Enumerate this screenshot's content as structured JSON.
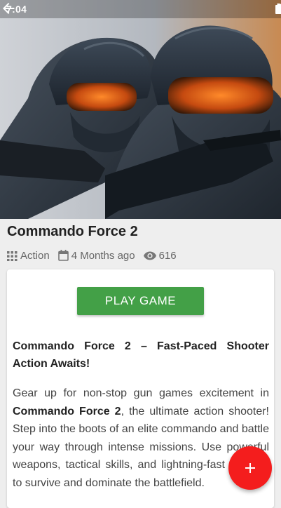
{
  "status_bar": {
    "time": "7:04",
    "icons": [
      "wifi-icon",
      "cell-signal-icon",
      "battery-icon"
    ]
  },
  "hero": {
    "image_subject": "two armed commandos in tactical helmets and goggles"
  },
  "toolbar": {
    "back_icon": "back-arrow-icon"
  },
  "game": {
    "title": "Commando Force 2",
    "category": "Action",
    "category_icon": "grid-icon",
    "date": "4 Months ago",
    "date_icon": "calendar-icon",
    "views": "616",
    "views_icon": "eye-icon"
  },
  "card": {
    "play_label": "PLAY GAME",
    "heading": "Commando Force 2 – Fast-Paced Shooter Action Awaits!",
    "p_prefix": "Gear up for non-stop gun games excitement in ",
    "p_bold": "Commando Force 2",
    "p_suffix": ", the ultimate action shooter! Step into the boots of an elite commando and battle your way through intense missions. Use powerful weapons, tactical skills, and lightning-fast reflexes to survive and dominate the battlefield."
  },
  "fab": {
    "icon": "plus-icon"
  },
  "colors": {
    "play_button": "#43a047",
    "fab": "#f41d1d",
    "background": "#eeeeee"
  }
}
